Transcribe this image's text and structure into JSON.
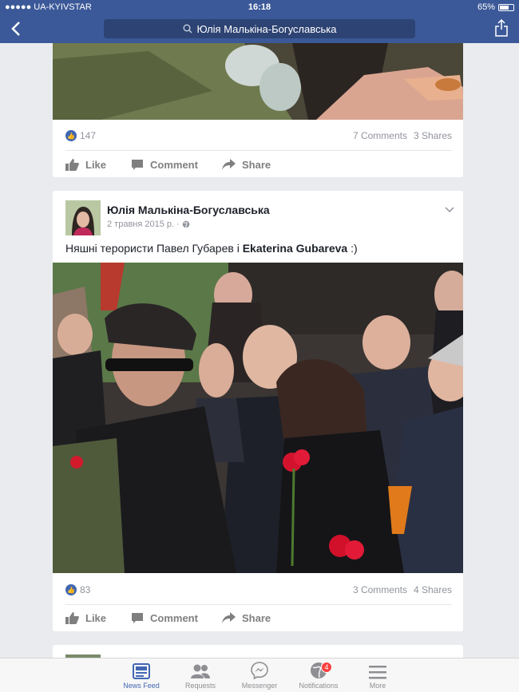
{
  "status_bar": {
    "carrier": "●●●●● UA-KYIVSTAR",
    "time": "16:18",
    "battery": "65%"
  },
  "nav": {
    "search_title": "Юлія Малькіна-Богуславська"
  },
  "post1": {
    "likes": "147",
    "comments": "7 Comments",
    "shares": "3 Shares"
  },
  "post2": {
    "author": "Юлія Малькіна-Богуславська",
    "date": "2 травня 2015 р.",
    "text_plain": "Няшні терористи Павел Губарев  і ",
    "text_bold": "Ekaterina Gubareva",
    "text_end": " :)",
    "likes": "83",
    "comments": "3 Comments",
    "shares": "4 Shares"
  },
  "actions": {
    "like": "Like",
    "comment": "Comment",
    "share": "Share"
  },
  "tabs": [
    {
      "label": "News Feed",
      "icon": "news-feed-icon",
      "active": true
    },
    {
      "label": "Requests",
      "icon": "requests-icon"
    },
    {
      "label": "Messenger",
      "icon": "messenger-icon"
    },
    {
      "label": "Notifications",
      "icon": "globe-icon",
      "badge": "4"
    },
    {
      "label": "More",
      "icon": "menu-icon"
    }
  ],
  "colors": {
    "brand": "#3b5998",
    "accent": "#4267b2",
    "badge": "#fa3e3e"
  }
}
